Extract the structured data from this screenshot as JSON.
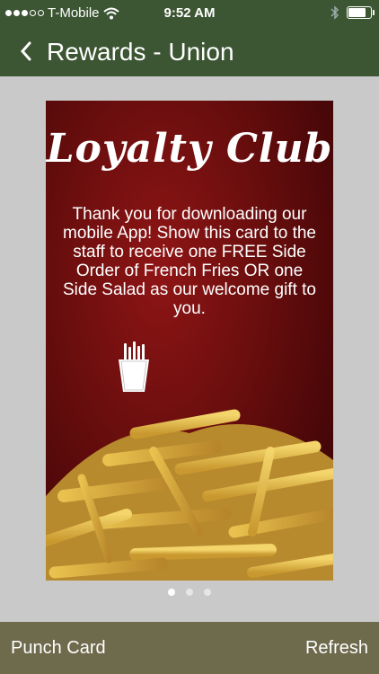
{
  "status_bar": {
    "carrier": "T-Mobile",
    "time": "9:52 AM",
    "signal_bars": 3,
    "battery_level": 0.8
  },
  "nav": {
    "back_glyph": "<",
    "title": "Rewards - Union"
  },
  "card": {
    "title": "Loyalty Club",
    "message": "Thank you for downloading our mobile App! Show this card to the staff to receive one FREE Side Order of French Fries OR one Side Salad as our welcome gift to you.",
    "icon": "french-fries-icon",
    "background_color": "#6b0e0e"
  },
  "pager": {
    "pages": 3,
    "current": 1
  },
  "bottom_bar": {
    "left_label": "Punch Card",
    "right_label": "Refresh"
  },
  "colors": {
    "header": "#3c5532",
    "bottom_bar": "#6e6a4c",
    "page_bg": "#c9c9c9"
  }
}
